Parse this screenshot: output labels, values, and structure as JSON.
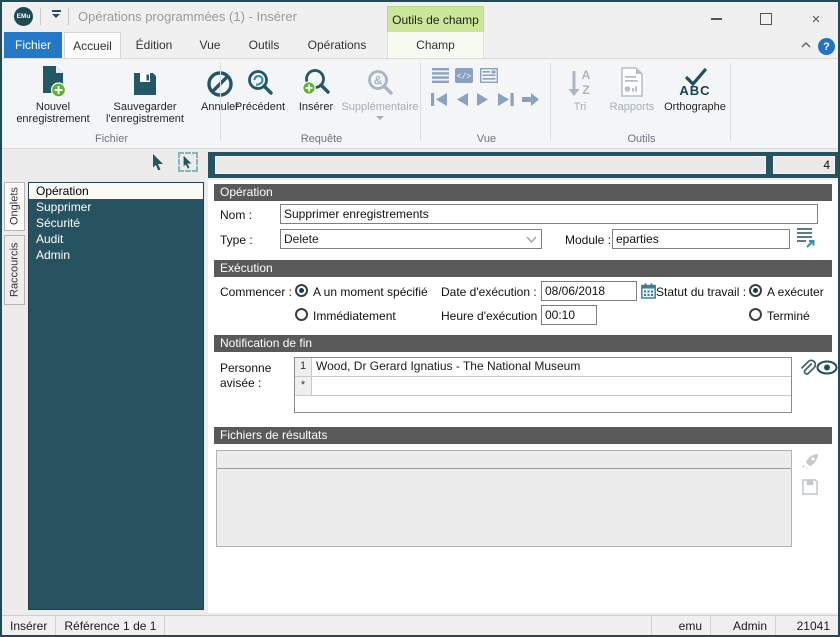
{
  "window": {
    "logo_text": "EMu",
    "title": "Opérations programmées (1) - Insérer",
    "record_count": "4"
  },
  "tabs": {
    "file_label": "Fichier",
    "items": [
      "Accueil",
      "Édition",
      "Vue",
      "Outils",
      "Opérations"
    ],
    "active": "Accueil",
    "contextual_group_label": "Outils de champ",
    "contextual_tab_label": "Champ",
    "help_label": "?"
  },
  "ribbon": {
    "groups": {
      "fichier": {
        "label": "Fichier",
        "new_record": "Nouvel enregistrement",
        "save_record": "Sauvegarder l'enregistrement",
        "cancel": "Annuler"
      },
      "requete": {
        "label": "Requête",
        "previous": "Précédent",
        "insert": "Insérer",
        "more": "Supplémentaire"
      },
      "vue": {
        "label": "Vue"
      },
      "outils": {
        "label": "Outils",
        "sort": "Tri",
        "reports": "Rapports",
        "spelling": "Orthographe"
      }
    }
  },
  "sidebar": {
    "tab_onglets": "Onglets",
    "tab_raccourcis": "Raccourcis",
    "items": [
      "Opération",
      "Supprimer",
      "Sécurité",
      "Audit",
      "Admin"
    ],
    "selected": "Opération"
  },
  "form": {
    "operation": {
      "header": "Opération",
      "nom_label": "Nom :",
      "nom_value": "Supprimer enregistrements",
      "type_label": "Type :",
      "type_value": "Delete",
      "module_label": "Module :",
      "module_value": "eparties"
    },
    "execution": {
      "header": "Exécution",
      "commencer_label": "Commencer :",
      "option_moment": "A un moment spécifié",
      "option_immediat": "Immédiatement",
      "date_label": "Date d'exécution :",
      "date_value": "08/06/2018",
      "heure_label": "Heure d'exécution :",
      "heure_value": "00:10",
      "statut_label": "Statut du travail :",
      "option_a_executer": "A exécuter",
      "option_termine": "Terminé"
    },
    "notification": {
      "header": "Notification de fin",
      "personne_label_line1": "Personne",
      "personne_label_line2": "avisée :",
      "rows": [
        {
          "num": "1",
          "value": "Wood, Dr Gerard Ignatius - The National Museum"
        },
        {
          "num": "*",
          "value": ""
        }
      ]
    },
    "resultats": {
      "header": "Fichiers de résultats"
    }
  },
  "statusbar": {
    "mode": "Insérer",
    "reference": "Référence 1 de 1",
    "server": "emu",
    "user": "Admin",
    "session": "21041"
  },
  "colors": {
    "teal_dark": "#235766",
    "sidebar_teal": "#27525f",
    "accent_blue": "#2478c8",
    "green": "#5cb431",
    "header_gray": "#595959",
    "contextual_green": "#cbe69b",
    "disabled_bluegray": "#8ba1bf"
  }
}
